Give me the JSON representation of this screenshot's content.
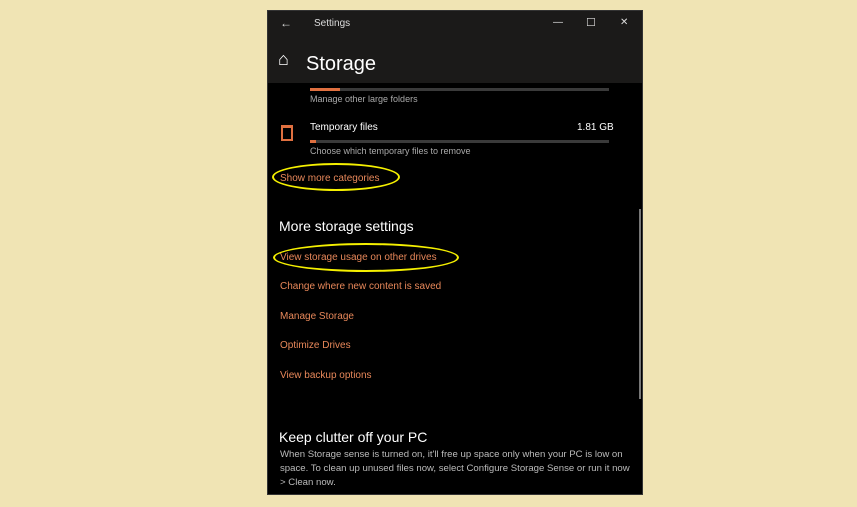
{
  "window": {
    "title": "Settings",
    "back": "←",
    "minimize": "—",
    "maximize": "☐",
    "close": "✕"
  },
  "header": {
    "home_icon": "⌂",
    "title": "Storage"
  },
  "categories": [
    {
      "name": "",
      "subtitle": "Manage other large folders",
      "usage_fraction": 0.1
    },
    {
      "name": "Temporary files",
      "size": "1.81 GB",
      "subtitle": "Choose which temporary files to remove",
      "usage_fraction": 0.02
    }
  ],
  "show_more": "Show more categories",
  "more_settings": {
    "heading": "More storage settings",
    "links": [
      "View storage usage on other drives",
      "Change where new content is saved",
      "Manage Storage",
      "Optimize Drives",
      "View backup options"
    ]
  },
  "clutter": {
    "heading": "Keep clutter off your PC",
    "body": "When Storage sense is turned on, it'll free up space only when your PC is low on space. To clean up unused files now, select Configure Storage Sense or run it now > Clean now."
  },
  "colors": {
    "accent": "#e8885a",
    "highlight": "#f5f000"
  }
}
